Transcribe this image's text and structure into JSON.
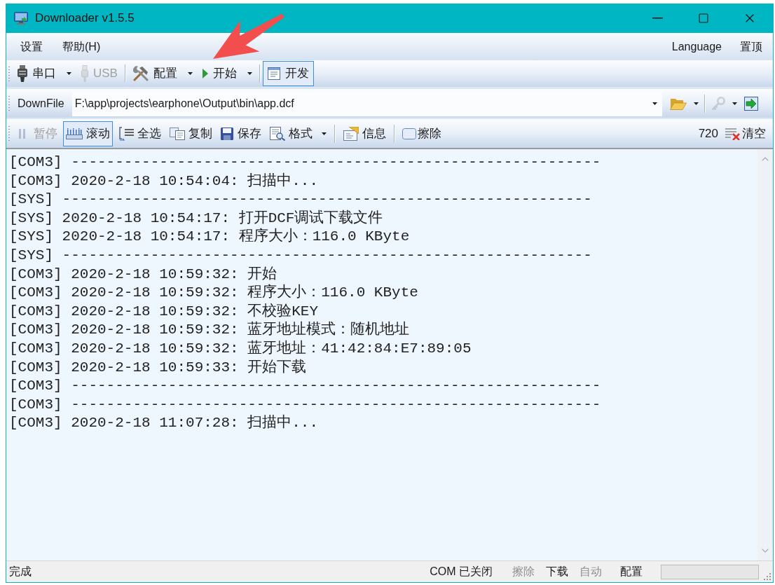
{
  "window": {
    "title": "Downloader v1.5.5"
  },
  "menu_bar": {
    "items": [
      {
        "label": "设置"
      },
      {
        "label": "帮助(H)"
      }
    ],
    "right_items": [
      {
        "label": "Language"
      },
      {
        "label": "置顶"
      }
    ]
  },
  "main_toolbar": {
    "groups": [
      {
        "items": [
          {
            "label": "串口",
            "disabled": false,
            "on": false,
            "dropdown": true
          },
          {
            "label": "USB",
            "disabled": true,
            "on": false,
            "dropdown": false
          }
        ]
      },
      {
        "items": [
          {
            "label": "配置",
            "disabled": false,
            "on": false,
            "dropdown": true
          },
          {
            "label": "开始",
            "disabled": false,
            "on": false,
            "dropdown": true
          }
        ]
      },
      {
        "items": [
          {
            "label": "开发",
            "disabled": false,
            "on": true,
            "dropdown": false
          }
        ]
      }
    ]
  },
  "file_bar": {
    "label": "DownFile",
    "path": "F:\\app\\projects\\earphone\\Output\\bin\\app.dcf",
    "buttons": [
      {
        "disabled": false,
        "dropdown": true
      },
      {
        "disabled": true,
        "dropdown": true
      },
      {
        "disabled": false,
        "dropdown": false
      }
    ]
  },
  "log_toolbar": {
    "groups": [
      {
        "items": [
          {
            "kind": "button",
            "label": "暂停",
            "disabled": true,
            "on": false,
            "dropdown": false
          },
          {
            "kind": "button",
            "label": "滚动",
            "disabled": false,
            "on": true,
            "dropdown": false
          },
          {
            "kind": "button",
            "label": "全选",
            "disabled": false,
            "on": false,
            "dropdown": false
          },
          {
            "kind": "button",
            "label": "复制",
            "disabled": false,
            "on": false,
            "dropdown": false
          },
          {
            "kind": "button",
            "label": "保存",
            "disabled": false,
            "on": false,
            "dropdown": false
          },
          {
            "kind": "button",
            "label": "格式",
            "disabled": false,
            "on": false,
            "dropdown": true
          }
        ]
      },
      {
        "items": [
          {
            "kind": "button",
            "label": "信息",
            "disabled": false,
            "on": false,
            "dropdown": false
          }
        ]
      },
      {
        "items": [
          {
            "kind": "checkbox",
            "label": "擦除",
            "checked": false
          }
        ]
      }
    ],
    "count": "720",
    "clear_button": {
      "label": "清空"
    }
  },
  "log": {
    "lines": [
      "[COM3] ------------------------------------------------------------",
      "[COM3] 2020-2-18 10:54:04: 扫描中...",
      "[SYS] ------------------------------------------------------------",
      "[SYS] 2020-2-18 10:54:17: 打开DCF调试下载文件",
      "[SYS] 2020-2-18 10:54:17: 程序大小：116.0 KByte",
      "[SYS] ------------------------------------------------------------",
      "[COM3] 2020-2-18 10:59:32: 开始",
      "[COM3] 2020-2-18 10:59:32: 程序大小：116.0 KByte",
      "[COM3] 2020-2-18 10:59:32: 不校验KEY",
      "[COM3] 2020-2-18 10:59:32: 蓝牙地址模式：随机地址",
      "[COM3] 2020-2-18 10:59:32: 蓝牙地址：41:42:84:E7:89:05",
      "[COM3] 2020-2-18 10:59:33: 开始下载",
      "[COM3] ------------------------------------------------------------",
      "[COM3] ------------------------------------------------------------",
      "[COM3] 2020-2-18 11:07:28: 扫描中..."
    ]
  },
  "status_bar": {
    "message": "完成",
    "port_status": "COM 已关闭",
    "indicators": [
      {
        "label": "擦除",
        "disabled": true
      },
      {
        "label": "下载",
        "disabled": false
      },
      {
        "label": "自动",
        "disabled": true
      },
      {
        "label": "配置",
        "disabled": false
      }
    ]
  }
}
